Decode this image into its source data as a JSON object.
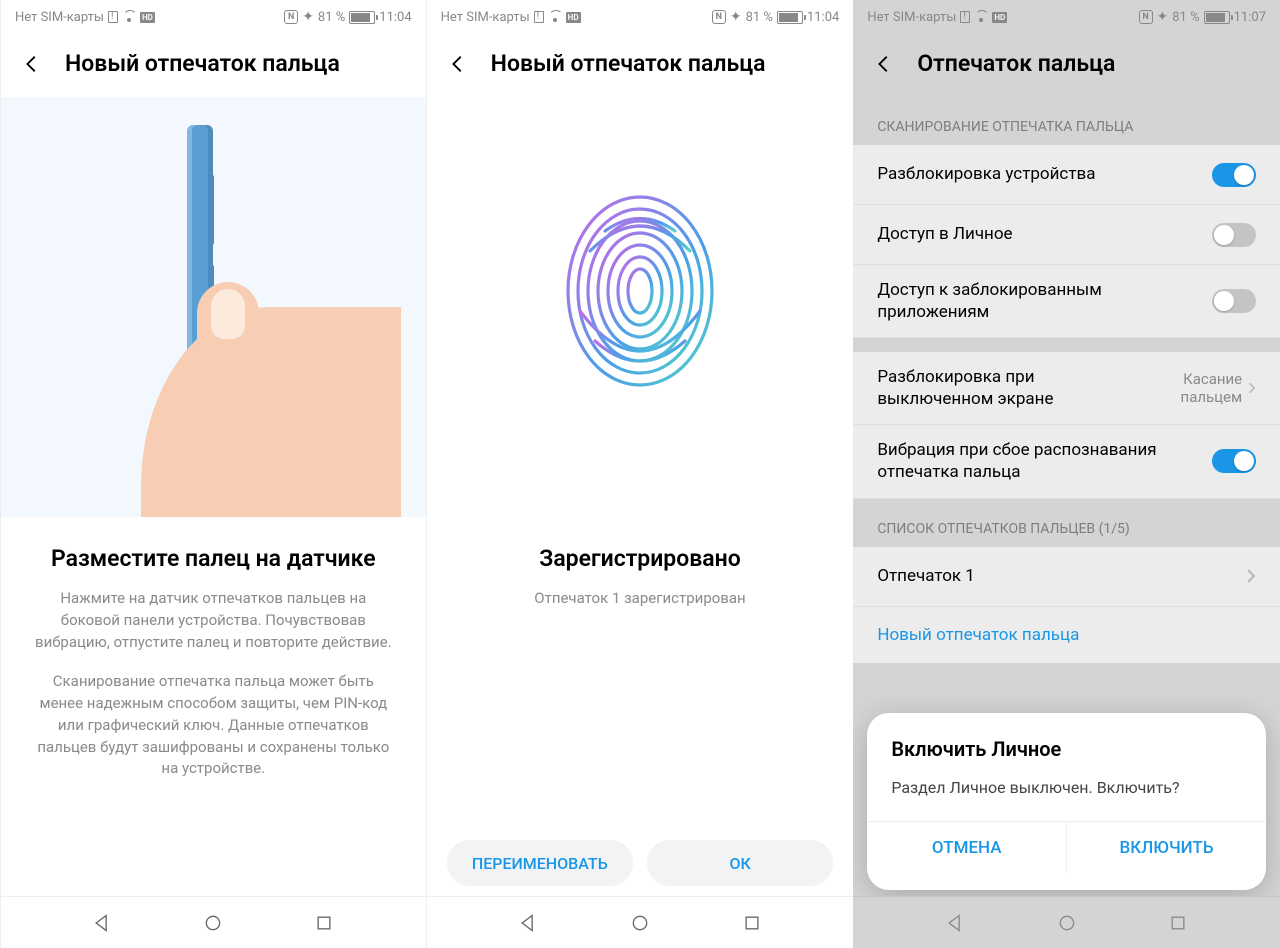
{
  "status": {
    "carrier": "Нет SIM-карты",
    "volte": "HD",
    "nfc": "N",
    "battery_pct": "81 %",
    "time_a": "11:04",
    "time_c": "11:07"
  },
  "screen1": {
    "header": "Новый отпечаток пальца",
    "title": "Разместите палец на датчике",
    "para1": "Нажмите на датчик отпечатков пальцев на боковой панели устройства. Почувствовав вибрацию, отпустите палец и повторите действие.",
    "para2": "Сканирование отпечатка пальца может быть менее надежным способом защиты, чем PIN-код или графический ключ. Данные отпечатков пальцев будут зашифрованы и сохранены только на устройстве."
  },
  "screen2": {
    "header": "Новый отпечаток пальца",
    "title": "Зарегистрировано",
    "sub": "Отпечаток 1 зарегистрирован",
    "btn_rename": "ПЕРЕИМЕНОВАТЬ",
    "btn_ok": "ОК"
  },
  "screen3": {
    "header": "Отпечаток пальца",
    "section1": "СКАНИРОВАНИЕ ОТПЕЧАТКА ПАЛЬЦА",
    "row_unlock": "Разблокировка устройства",
    "row_safe": "Доступ в Личное",
    "row_applock": "Доступ к заблокированным приложениям",
    "row_screenoff": "Разблокировка при выключенном экране",
    "row_screenoff_val": "Касание пальцем",
    "row_vibe": "Вибрация при сбое распознавания отпечатка пальца",
    "section2": "СПИСОК ОТПЕЧАТКОВ ПАЛЬЦЕВ (1/5)",
    "fp1": "Отпечаток 1",
    "new_fp": "Новый отпечаток пальца",
    "dialog": {
      "title": "Включить Личное",
      "msg": "Раздел Личное выключен. Включить?",
      "cancel": "ОТМЕНА",
      "ok": "ВКЛЮЧИТЬ"
    }
  }
}
